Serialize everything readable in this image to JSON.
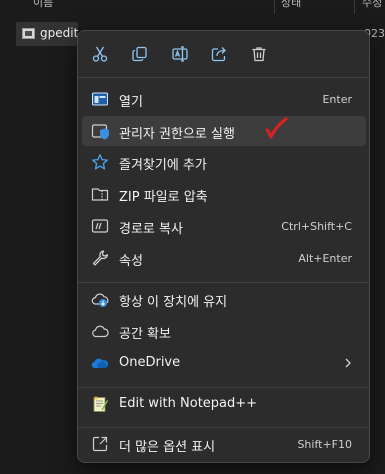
{
  "explorer": {
    "header_col1": "이름",
    "header_col2": "상태",
    "header_col3": "수정",
    "file_name": "gpedit",
    "right_fragment": "023"
  },
  "menu": {
    "quick_actions": [
      {
        "name": "cut",
        "icon": "scissors-icon"
      },
      {
        "name": "copy",
        "icon": "copy-icon"
      },
      {
        "name": "rename",
        "icon": "rename-icon"
      },
      {
        "name": "share",
        "icon": "share-icon"
      },
      {
        "name": "delete",
        "icon": "trash-icon"
      }
    ],
    "items": [
      {
        "label": "열기",
        "shortcut": "Enter",
        "icon": "open-app-icon"
      },
      {
        "label": "관리자 권한으로 실행",
        "shortcut": "",
        "icon": "shield-icon",
        "highlighted": true
      },
      {
        "label": "즐겨찾기에 추가",
        "shortcut": "",
        "icon": "star-icon"
      },
      {
        "label": "ZIP 파일로 압축",
        "shortcut": "",
        "icon": "zip-folder-icon"
      },
      {
        "label": "경로로 복사",
        "shortcut": "Ctrl+Shift+C",
        "icon": "copy-path-icon"
      },
      {
        "label": "속성",
        "shortcut": "Alt+Enter",
        "icon": "wrench-icon"
      },
      {
        "label": "항상 이 장치에 유지",
        "shortcut": "",
        "icon": "cloud-download-icon"
      },
      {
        "label": "공간 확보",
        "shortcut": "",
        "icon": "cloud-icon"
      },
      {
        "label": "OneDrive",
        "shortcut": "",
        "icon": "onedrive-icon",
        "submenu": true
      },
      {
        "label": "Edit with Notepad++",
        "shortcut": "",
        "icon": "notepad-plus-plus-icon"
      },
      {
        "label": "더 많은 옵션 표시",
        "shortcut": "Shift+F10",
        "icon": "more-options-icon"
      }
    ]
  },
  "colors": {
    "menu_bg": "#2c2c2c",
    "highlight": "#3d3d3d",
    "accent_blue": "#4aa3f0",
    "check_red": "#e0201f"
  }
}
